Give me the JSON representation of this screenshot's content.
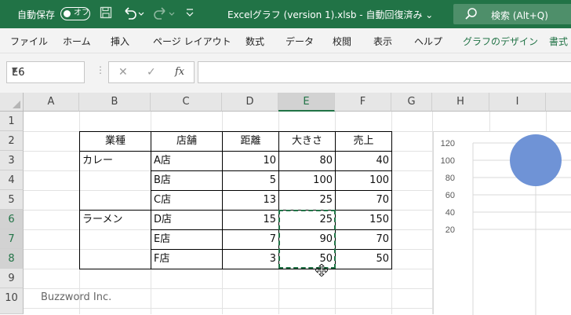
{
  "titlebar": {
    "autosave_label": "自動保存",
    "autosave_state": "オフ",
    "doc_title": "Excelグラフ (version 1).xlsb  -  自動回復済み  ⌄",
    "search_placeholder": "検索 (Alt+Q)"
  },
  "ribbon": {
    "tabs": [
      "ファイル",
      "ホーム",
      "挿入",
      "ページ レイアウト",
      "数式",
      "データ",
      "校閲",
      "表示",
      "ヘルプ",
      "グラフのデザイン",
      "書式"
    ]
  },
  "formula_bar": {
    "name_box": "E6",
    "cancel_icon": "✕",
    "enter_icon": "✓",
    "fx_icon": "fx",
    "formula": ""
  },
  "sheet": {
    "columns": [
      "A",
      "B",
      "C",
      "D",
      "E",
      "F",
      "G",
      "H",
      "I"
    ],
    "rows": [
      "1",
      "2",
      "3",
      "4",
      "5",
      "6",
      "7",
      "8",
      "9",
      "10"
    ],
    "table": {
      "headers": [
        "業種",
        "店舗",
        "距離",
        "大きさ",
        "売上"
      ],
      "groups": [
        "カレー",
        "ラーメン"
      ],
      "rows": [
        {
          "store": "A店",
          "distance": "10",
          "size": "80",
          "sales": "40"
        },
        {
          "store": "B店",
          "distance": "5",
          "size": "100",
          "sales": "100"
        },
        {
          "store": "C店",
          "distance": "13",
          "size": "25",
          "sales": "70"
        },
        {
          "store": "D店",
          "distance": "15",
          "size": "25",
          "sales": "150"
        },
        {
          "store": "E店",
          "distance": "7",
          "size": "90",
          "sales": "70"
        },
        {
          "store": "F店",
          "distance": "3",
          "size": "50",
          "sales": "50"
        }
      ]
    }
  },
  "watermark": "Buzzword Inc.",
  "chart_data": {
    "type": "scatter",
    "y_ticks": [
      "120",
      "100",
      "80",
      "60",
      "40",
      "20"
    ],
    "ylim": [
      0,
      120
    ],
    "visible_bubble": {
      "y": 100
    },
    "bubble_color": "#6f93d6",
    "grid": true
  }
}
